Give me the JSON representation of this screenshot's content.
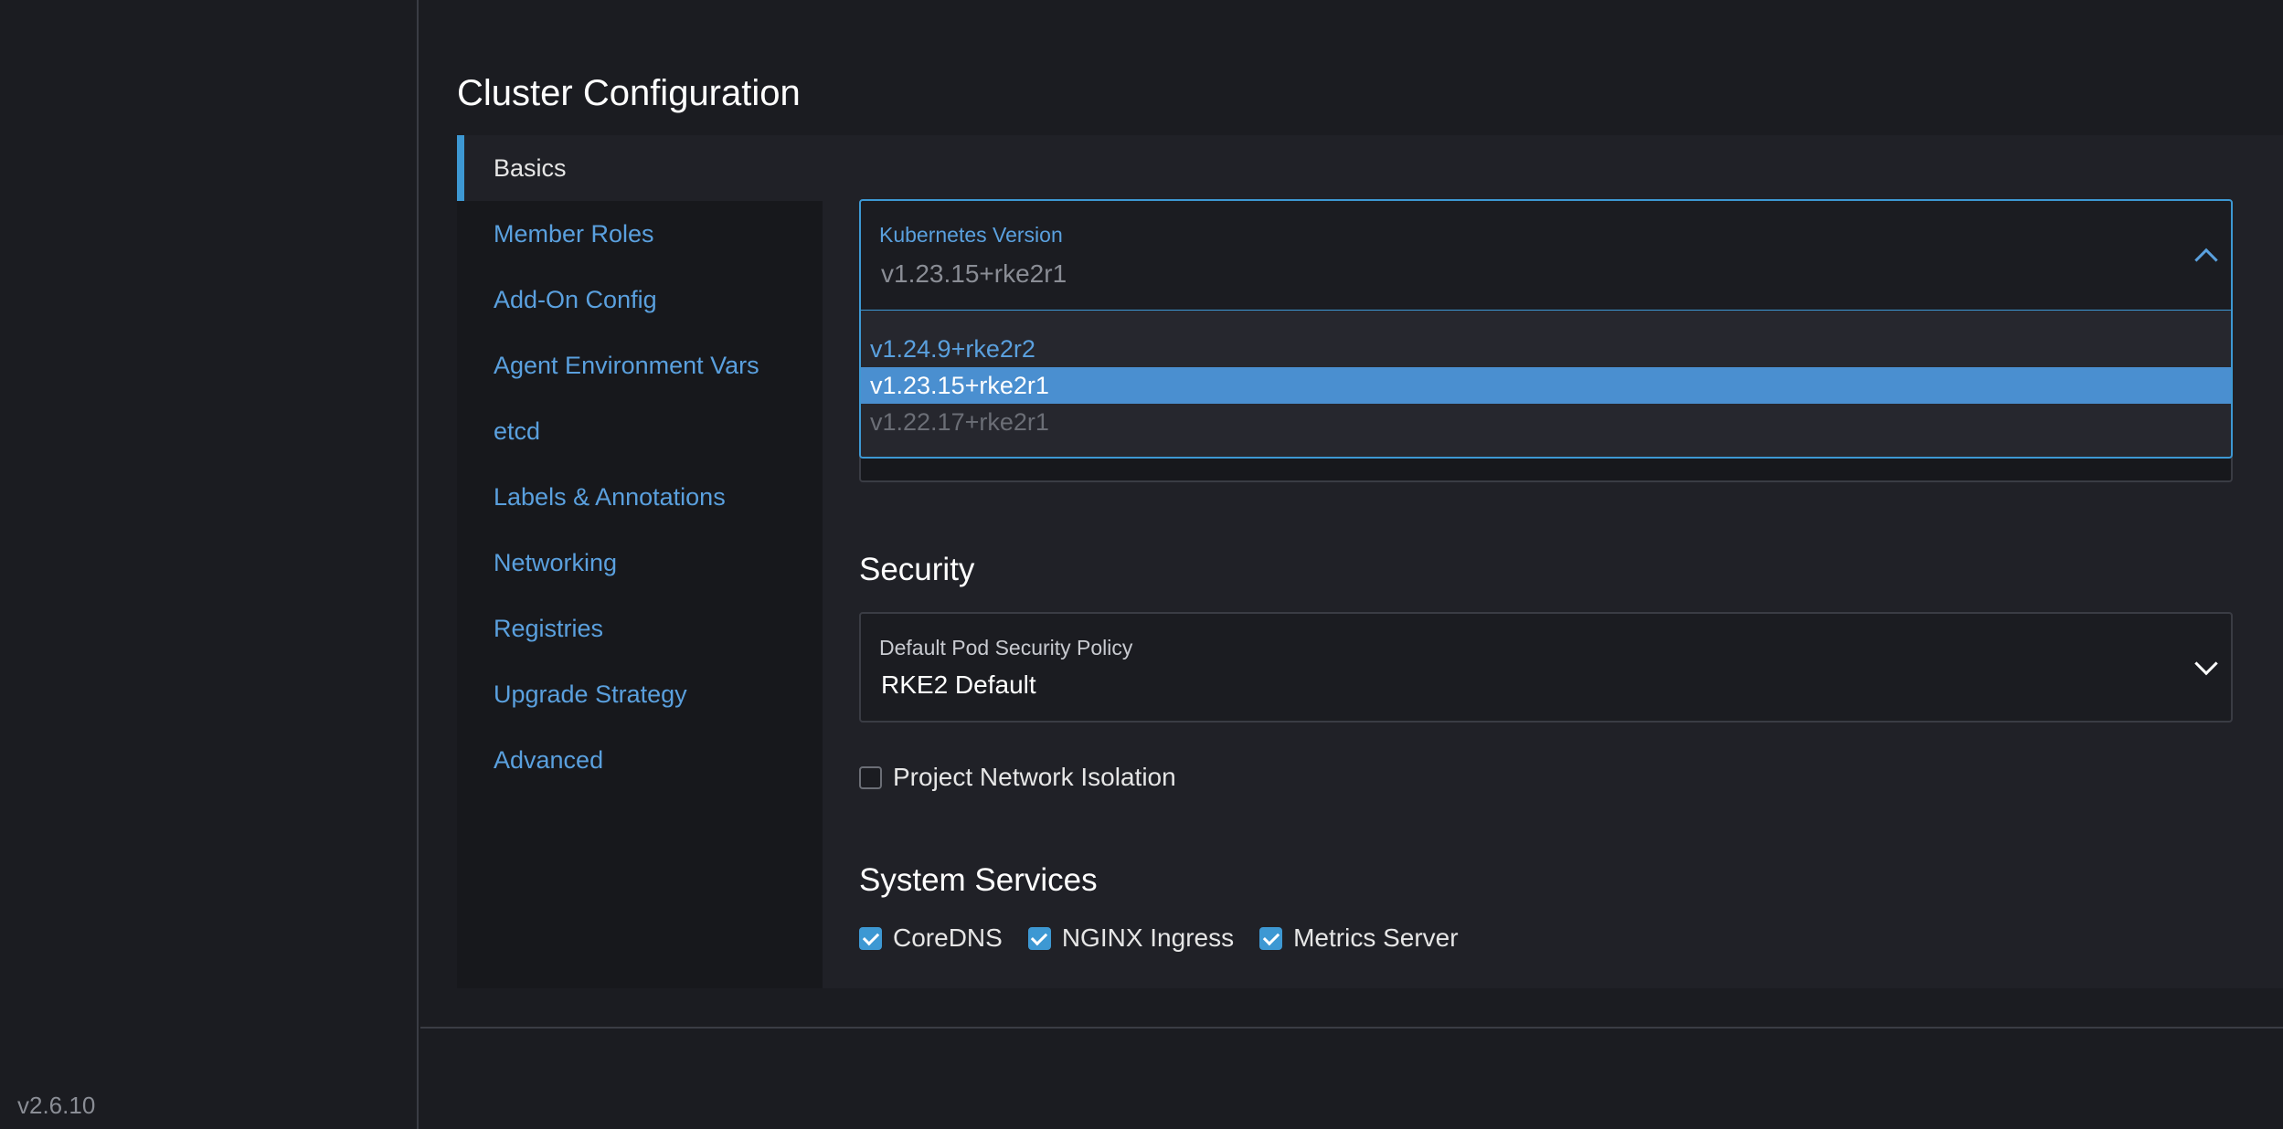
{
  "sidebar": {
    "version": "v2.6.10"
  },
  "page": {
    "title": "Cluster Configuration"
  },
  "tabs": [
    {
      "label": "Basics",
      "active": true
    },
    {
      "label": "Member Roles"
    },
    {
      "label": "Add-On Config"
    },
    {
      "label": "Agent Environment Vars"
    },
    {
      "label": "etcd"
    },
    {
      "label": "Labels & Annotations"
    },
    {
      "label": "Networking"
    },
    {
      "label": "Registries"
    },
    {
      "label": "Upgrade Strategy"
    },
    {
      "label": "Advanced"
    }
  ],
  "kubernetes_version": {
    "label": "Kubernetes Version",
    "value": "v1.23.15+rke2r1",
    "options": [
      "v1.24.9+rke2r2",
      "v1.23.15+rke2r1",
      "v1.22.17+rke2r1"
    ],
    "selected_index": 1,
    "disabled_index": 2,
    "open": true
  },
  "security": {
    "title": "Security",
    "psp_label": "Default Pod Security Policy",
    "psp_value": "RKE2 Default",
    "project_network_isolation": {
      "label": "Project Network Isolation",
      "checked": false
    }
  },
  "system_services": {
    "title": "System Services",
    "items": [
      {
        "label": "CoreDNS",
        "checked": true
      },
      {
        "label": "NGINX Ingress",
        "checked": true
      },
      {
        "label": "Metrics Server",
        "checked": true
      }
    ]
  },
  "colors": {
    "accent": "#3d98d3",
    "link": "#5aa0de",
    "selected_option_bg": "#4a8fd0",
    "background": "#1b1c21"
  }
}
